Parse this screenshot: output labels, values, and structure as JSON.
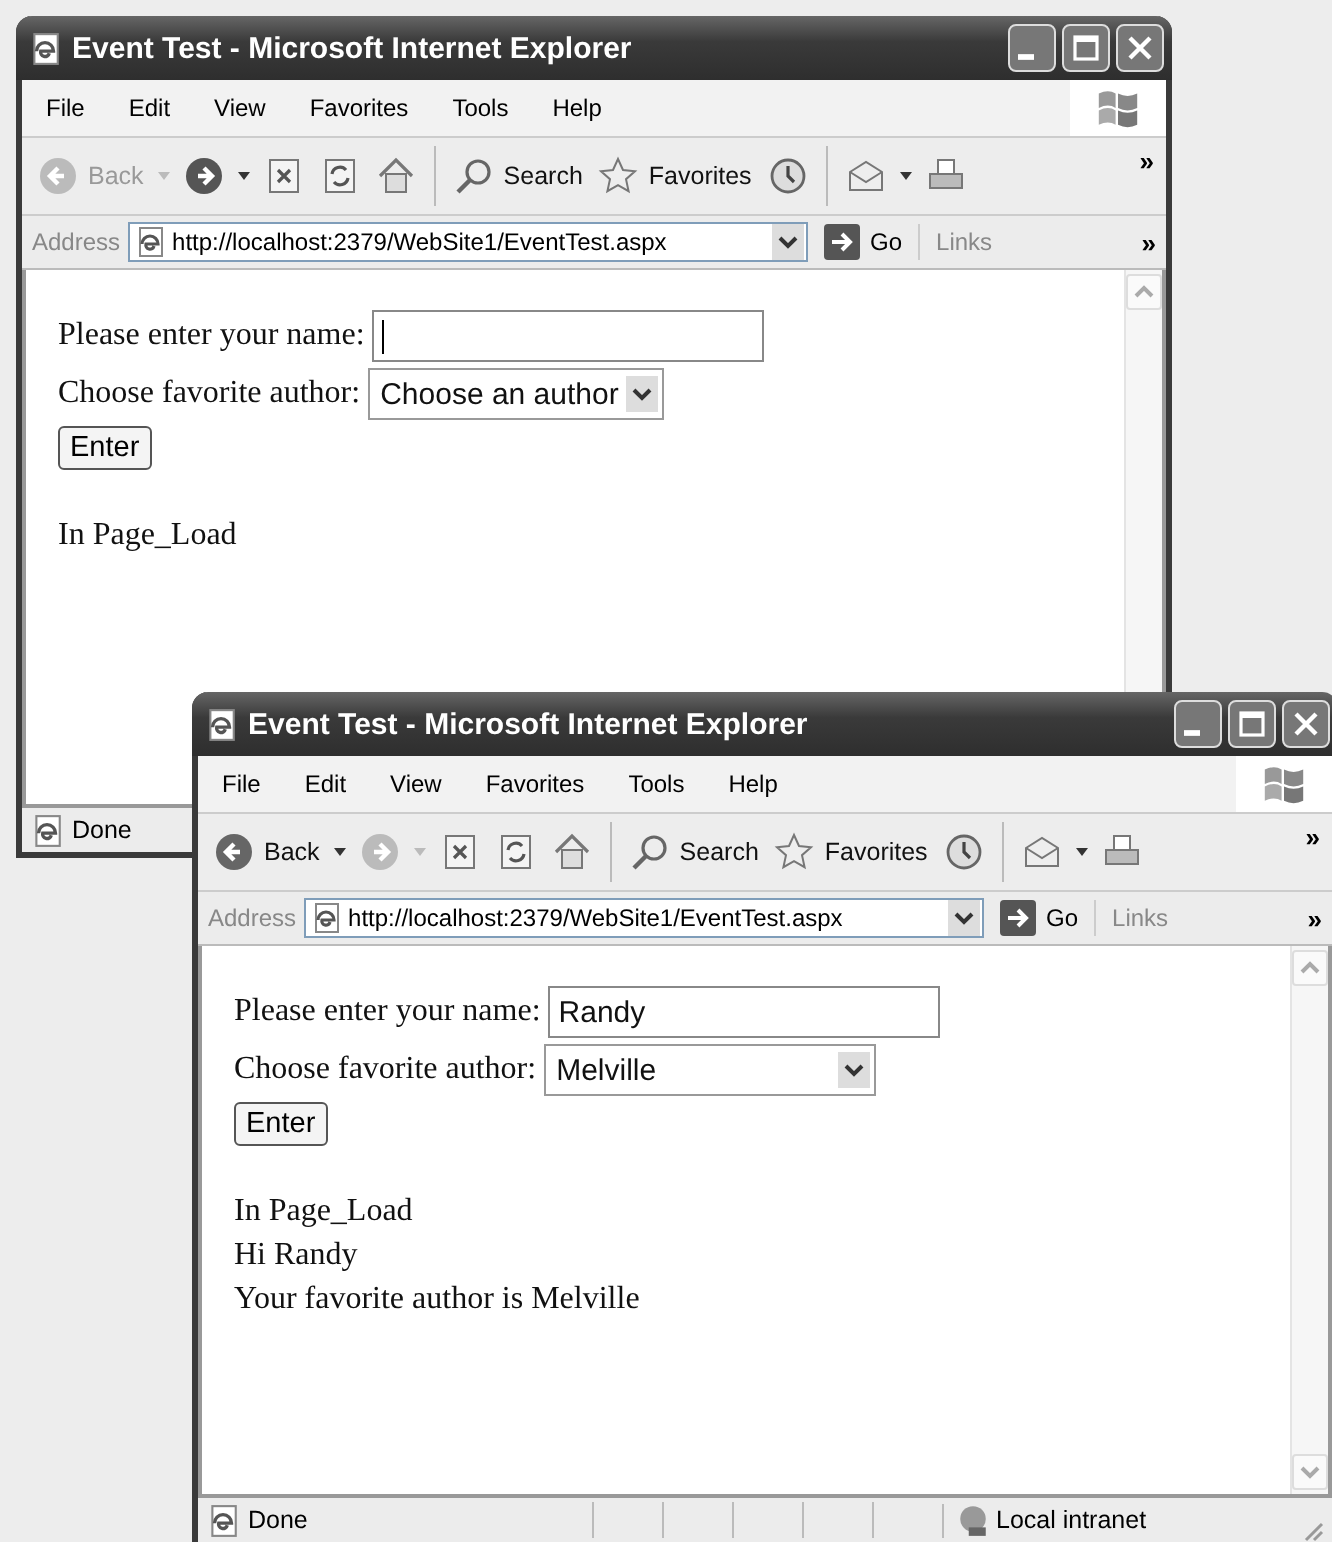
{
  "windows": [
    {
      "title": "Event Test - Microsoft Internet Explorer",
      "menu": [
        "File",
        "Edit",
        "View",
        "Favorites",
        "Tools",
        "Help"
      ],
      "toolbar": {
        "back": {
          "label": "Back",
          "disabled": true
        },
        "forward": {
          "disabled": false
        },
        "search": "Search",
        "favorites": "Favorites",
        "more": "»"
      },
      "address": {
        "label": "Address",
        "url": "http://localhost:2379/WebSite1/EventTest.aspx",
        "go": "Go",
        "links": "Links",
        "more": "»"
      },
      "form": {
        "name_label": "Please enter your name:",
        "name_focused": true,
        "author_label": "Choose favorite author:",
        "author_value": "Choose an author",
        "button": "Enter"
      },
      "output": [
        "In Page_Load"
      ],
      "status": {
        "text": "Done"
      }
    },
    {
      "title": "Event Test - Microsoft Internet Explorer",
      "menu": [
        "File",
        "Edit",
        "View",
        "Favorites",
        "Tools",
        "Help"
      ],
      "toolbar": {
        "back": {
          "label": "Back",
          "disabled": false
        },
        "forward": {
          "disabled": true
        },
        "search": "Search",
        "favorites": "Favorites",
        "more": "»"
      },
      "address": {
        "label": "Address",
        "url": "http://localhost:2379/WebSite1/EventTest.aspx",
        "go": "Go",
        "links": "Links",
        "more": "»"
      },
      "form": {
        "name_label": "Please enter your name:",
        "name_value": "Randy",
        "name_focused": false,
        "author_label": "Choose favorite author:",
        "author_value": "Melville",
        "button": "Enter"
      },
      "output": [
        "In Page_Load",
        "Hi Randy",
        "Your favorite author is Melville"
      ],
      "status": {
        "text": "Done",
        "zone": "Local intranet"
      }
    }
  ]
}
